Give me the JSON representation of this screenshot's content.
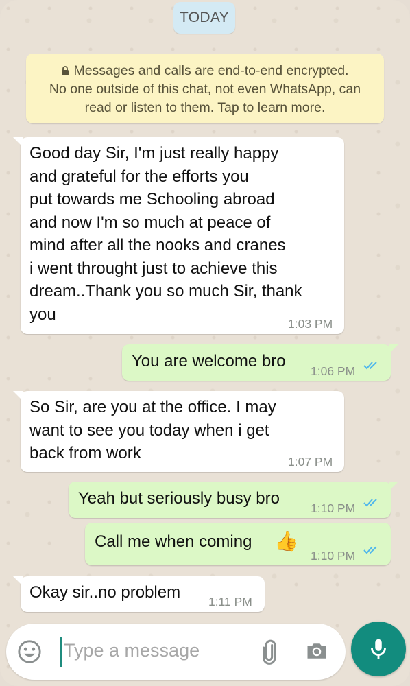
{
  "date_label": "TODAY",
  "encryption_notice": {
    "lines": [
      "Messages and calls are end-to-end encrypted.",
      "No one outside of this chat, not even WhatsApp, can",
      "read or listen to them. Tap to learn more."
    ]
  },
  "messages": [
    {
      "direction": "incoming",
      "text": "Good day Sir, I'm just really happy\nand  grateful for the efforts you\nput towards me Schooling abroad\nand now I'm so much at peace of\nmind after all the nooks and cranes\ni went throught just to achieve this\ndream..Thank you so much Sir, thank\nyou",
      "time": "1:03 PM"
    },
    {
      "direction": "outgoing",
      "text": "You are welcome bro",
      "time": "1:06 PM",
      "status": "read"
    },
    {
      "direction": "incoming",
      "text": "So Sir, are you at the office. I may\nwant to see you today when i get\nback from work",
      "time": "1:07 PM"
    },
    {
      "direction": "outgoing",
      "text": "Yeah but seriously busy bro",
      "time": "1:10 PM",
      "status": "read"
    },
    {
      "direction": "outgoing",
      "text": "Call me when coming",
      "emoji": "👍",
      "time": "1:10 PM",
      "status": "read"
    },
    {
      "direction": "incoming",
      "text": "Okay sir..no problem",
      "time": "1:11 PM"
    }
  ],
  "composer": {
    "placeholder": "Type a message",
    "icons": [
      "emoji-icon",
      "attach-icon",
      "camera-icon",
      "mic-icon"
    ]
  },
  "colors": {
    "incoming_bubble": "#ffffff",
    "outgoing_bubble": "#dcf8c6",
    "read_ticks": "#4fb6ec",
    "mic_button": "#128c7e",
    "banner": "#fcf4c4",
    "date_pill": "#d4eaf4"
  }
}
